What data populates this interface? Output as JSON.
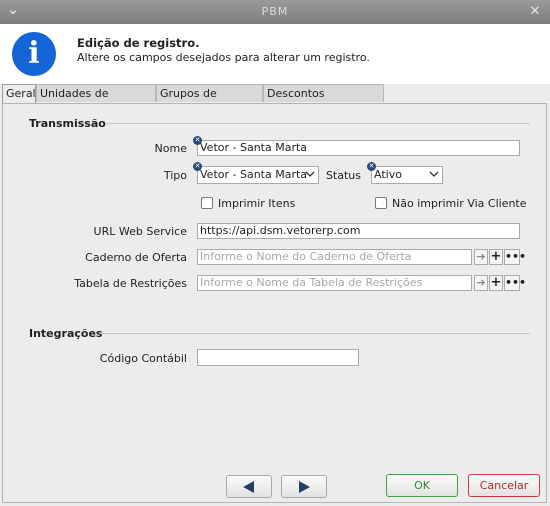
{
  "window": {
    "title": "PBM",
    "menu_glyph": "⌄",
    "close_glyph": "✕"
  },
  "header": {
    "icon": "info-icon",
    "icon_glyph": "i",
    "title": "Edição de registro.",
    "subtitle": "Altere os campos desejados para alterar um registro."
  },
  "tabs": [
    {
      "label": "Geral",
      "active": true
    },
    {
      "label": "Unidades de Negócio",
      "active": false
    },
    {
      "label": "Grupos de Produto",
      "active": false
    },
    {
      "label": "Descontos Adicionais",
      "active": false
    }
  ],
  "transmissao": {
    "title": "Transmissão",
    "nome": {
      "label": "Nome",
      "value": "Vetor - Santa Marta"
    },
    "tipo": {
      "label": "Tipo",
      "value": "Vetor - Santa Marta"
    },
    "status": {
      "label": "Status",
      "value": "Ativo"
    },
    "imprimir_itens": {
      "label": "Imprimir Itens",
      "checked": false
    },
    "nao_imprimir": {
      "label": "Não imprimir Via Cliente",
      "checked": false
    },
    "url": {
      "label": "URL Web Service",
      "value": "https://api.dsm.vetorerp.com"
    },
    "caderno": {
      "label": "Caderno de Oferta",
      "placeholder": "Informe o Nome do Caderno de Oferta"
    },
    "tabela": {
      "label": "Tabela de Restrições",
      "placeholder": "Informe o Nome da Tabela de Restrições"
    }
  },
  "integracoes": {
    "title": "Integrações",
    "codigo": {
      "label": "Código Contábil",
      "value": ""
    }
  },
  "footer": {
    "ok_label": "OK",
    "cancel_label": "Cancelar",
    "prev_icon": "arrow-left-icon",
    "next_icon": "arrow-right-icon"
  },
  "colors": {
    "ok_border": "#3aa53a",
    "cancel_border": "#c83a3a",
    "nav_arrow": "#1f3f66",
    "info_icon": "#1565d8"
  }
}
